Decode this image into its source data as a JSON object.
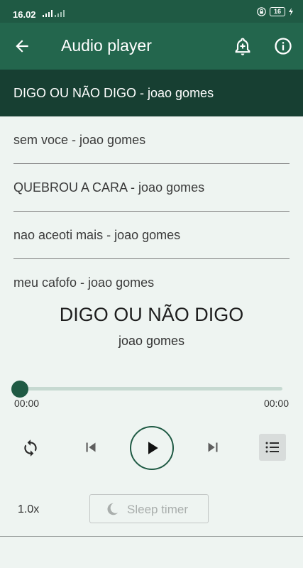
{
  "status_bar": {
    "time": "16.02",
    "battery": "16"
  },
  "app_bar": {
    "title": "Audio player",
    "back_icon": "arrow-left-icon",
    "alarm_icon": "alarm-add-icon",
    "info_icon": "info-icon"
  },
  "playlist": {
    "items": [
      {
        "label": "DIGO OU NÃO DIGO - joao gomes"
      },
      {
        "label": "sem voce - joao gomes"
      },
      {
        "label": "QUEBROU A CARA - joao gomes"
      },
      {
        "label": "nao aceoti mais - joao gomes"
      },
      {
        "label": "meu cafofo - joao gomes"
      }
    ]
  },
  "now_playing": {
    "title": "DIGO OU NÃO DIGO",
    "artist": "joao gomes",
    "position": "00:00",
    "duration": "00:00",
    "progress": 0
  },
  "controls": {
    "repeat_icon": "repeat-icon",
    "prev_icon": "skip-previous-icon",
    "play_icon": "play-icon",
    "next_icon": "skip-next-icon",
    "list_icon": "playlist-icon"
  },
  "speed": "1.0x",
  "sleep_timer": {
    "label": "Sleep timer",
    "icon": "moon-icon"
  },
  "colors": {
    "primary": "#23664d",
    "primary_dark": "#1f5a44",
    "selected_row": "#173f32",
    "background": "#eef4f1"
  }
}
